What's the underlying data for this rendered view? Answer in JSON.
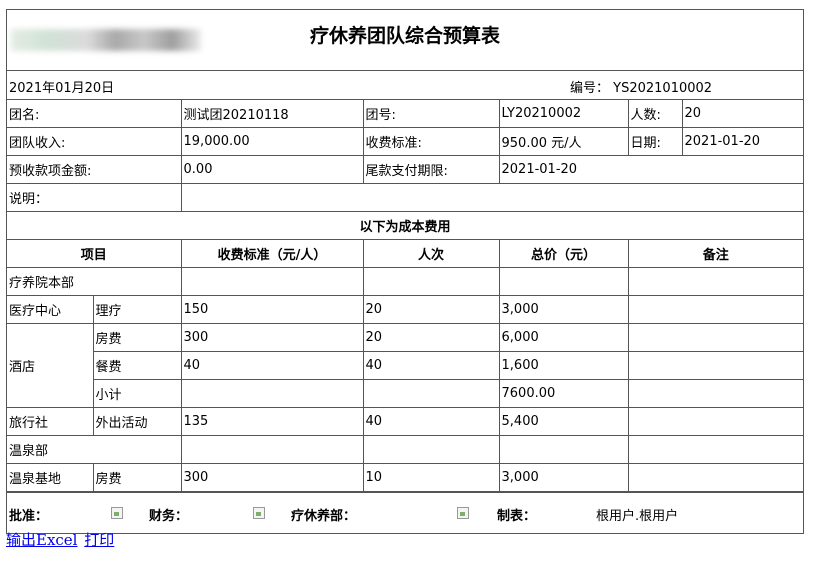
{
  "title": "疗休养团队综合预算表",
  "date": "2021年01月20日",
  "code_label": "编号：",
  "code_value": "YS2021010002",
  "info": {
    "group_name_label": "团名:",
    "group_name": "测试团20210118",
    "group_no_label": "团号:",
    "group_no": "LY20210002",
    "headcount_label": "人数:",
    "headcount": "20",
    "income_label": "团队收入:",
    "income": "19,000.00",
    "fee_std_label": "收费标准:",
    "fee_std": "950.00 元/人",
    "date_label": "日期:",
    "date_value": "2021-01-20",
    "prepaid_label": "预收款项金额:",
    "prepaid": "0.00",
    "deadline_label": "尾款支付期限:",
    "deadline": "2021-01-20",
    "note_label": "说明："
  },
  "cost_section_title": "以下为成本费用",
  "cost_headers": [
    "项目",
    "收费标准（元/人）",
    "人次",
    "总价（元）",
    "备注"
  ],
  "rows": {
    "r1": {
      "group": "疗养院本部"
    },
    "r2": {
      "group": "医疗中心",
      "item": "理疗",
      "std": "150",
      "count": "20",
      "total": "3,000"
    },
    "r3": {
      "group": "酒店",
      "item": "房费",
      "std": "300",
      "count": "20",
      "total": "6,000"
    },
    "r4": {
      "item": "餐费",
      "std": "40",
      "count": "40",
      "total": "1,600"
    },
    "r5": {
      "item": "小计",
      "total": "7600.00"
    },
    "r6": {
      "group": "旅行社",
      "item": "外出活动",
      "std": "135",
      "count": "40",
      "total": "5,400"
    },
    "r7": {
      "group": "温泉部"
    },
    "r8": {
      "group": "温泉基地",
      "item": "房费",
      "std": "300",
      "count": "10",
      "total": "3,000"
    }
  },
  "signatures": {
    "approve": "批准：",
    "finance": "财务：",
    "dept": "疗休养部：",
    "maker": "制表：",
    "maker_name": "根用户.根用户"
  },
  "links": {
    "export": "输出Excel",
    "print": "打印"
  }
}
